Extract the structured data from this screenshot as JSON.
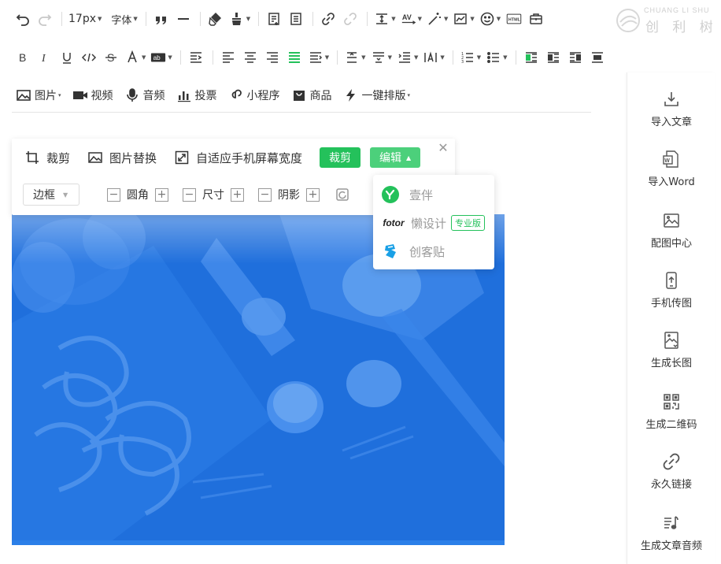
{
  "toolbar1": {
    "font_size": "17px",
    "font_family": "字体"
  },
  "toolbar3": {
    "image": "图片",
    "video": "视频",
    "audio": "音频",
    "vote": "投票",
    "miniapp": "小程序",
    "goods": "商品",
    "one_click": "一键排版"
  },
  "logo": {
    "en": "CHUANG LI SHU",
    "cn": "创 利 树"
  },
  "sidebar": {
    "items": [
      {
        "label": "导入文章",
        "icon": "import-icon"
      },
      {
        "label": "导入Word",
        "icon": "word-icon"
      },
      {
        "label": "配图中心",
        "icon": "image-center-icon"
      },
      {
        "label": "手机传图",
        "icon": "phone-upload-icon"
      },
      {
        "label": "生成长图",
        "icon": "long-image-icon"
      },
      {
        "label": "生成二维码",
        "icon": "qrcode-icon"
      },
      {
        "label": "永久链接",
        "icon": "link-icon"
      },
      {
        "label": "生成文章音频",
        "icon": "music-icon"
      }
    ]
  },
  "image_toolbar": {
    "crop": "裁剪",
    "replace": "图片替换",
    "fit": "自适应手机屏幕宽度",
    "crop_button": "裁剪",
    "edit_button": "编辑",
    "close": "✕",
    "border_select": "边框",
    "radius": "圆角",
    "size": "尺寸",
    "shadow": "阴影"
  },
  "edit_menu": {
    "items": [
      {
        "label": "壹伴"
      },
      {
        "label": "懒设计",
        "badge": "专业版",
        "brand": "fotor"
      },
      {
        "label": "创客贴"
      }
    ]
  },
  "colors": {
    "accent_green": "#24c15b",
    "image_blue": "#1e6fdc"
  }
}
